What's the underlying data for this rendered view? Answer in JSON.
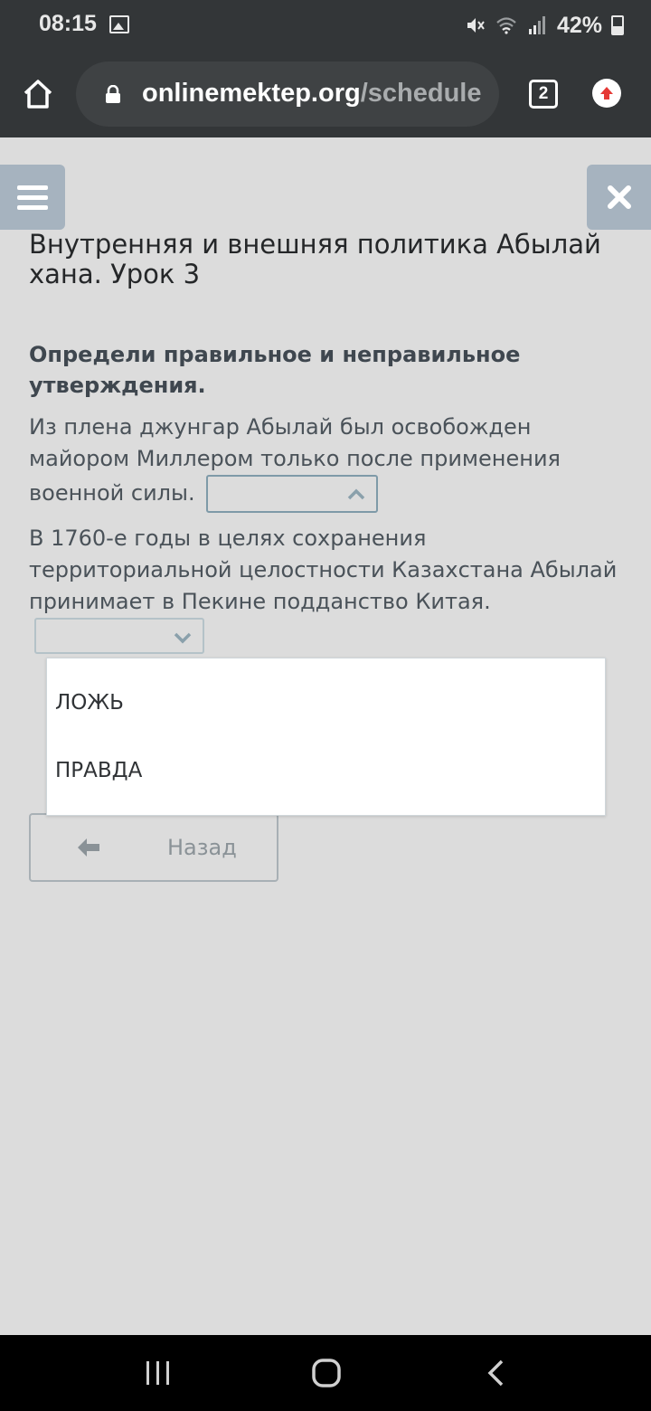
{
  "status_bar": {
    "time": "08:15",
    "battery_percent": "42%",
    "icons": [
      "image-icon",
      "mute-icon",
      "wifi-icon",
      "signal-icon",
      "battery-icon"
    ]
  },
  "browser": {
    "url_domain": "onlinemektep.org",
    "url_path": "/schedule",
    "tab_count": "2",
    "icons": [
      "home-icon",
      "lock-icon",
      "upload-icon"
    ]
  },
  "page": {
    "title": "Внутренняя и внешняя политика Абылай хана. Урок 3",
    "instruction": "Определи правильное и неправильное утверждения.",
    "statements": [
      {
        "text": "Из плена джунгар Абылай был освобожден майором Миллером только после применения военной силы.",
        "selected": "",
        "expanded": true
      },
      {
        "text": "В 1760-е годы в целях сохранения территориальной целостности Казахстана Абылай принимает в Пекине подданство Китая.",
        "selected": "",
        "expanded": false
      }
    ],
    "dropdown_options": [
      "ЛОЖЬ",
      "ПРАВДА"
    ],
    "back_label": "Назад"
  },
  "colors": {
    "status_bg": "#333638",
    "page_bg": "#dcdcdc",
    "side_button_bg": "#a6b3bf",
    "text_dark": "#3f474f",
    "upload_accent": "#e53935"
  }
}
